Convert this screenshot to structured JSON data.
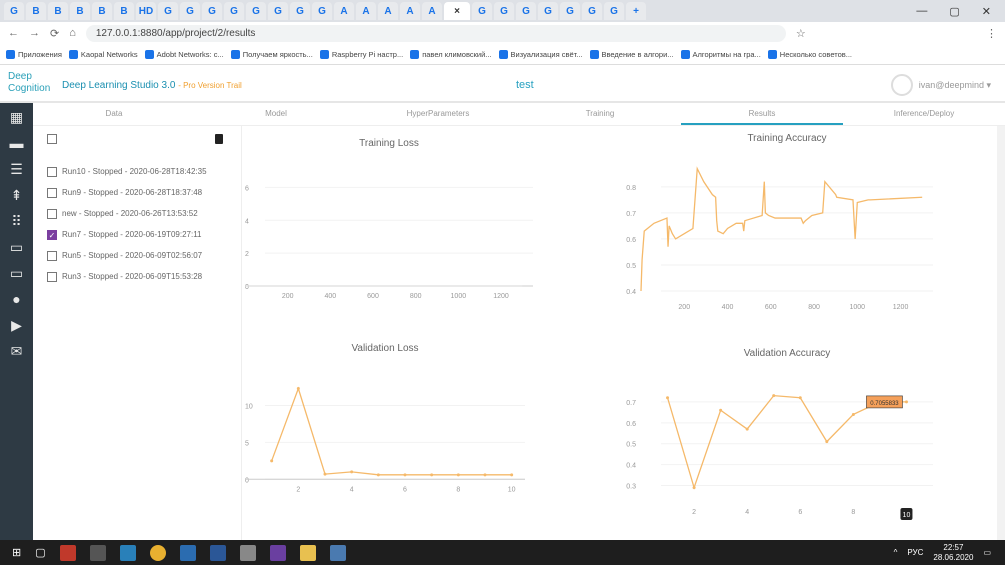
{
  "browser": {
    "url": "127.0.0.1:8880/app/project/2/results",
    "tabs": [
      "G",
      "B",
      "B",
      "B",
      "B",
      "B",
      "HD",
      "G",
      "G",
      "G",
      "G",
      "G",
      "G",
      "G",
      "G",
      "A",
      "A",
      "A",
      "A",
      "A",
      "×",
      "G",
      "G",
      "G",
      "G",
      "G",
      "G",
      "G",
      "+"
    ],
    "bookmarks": [
      "Приложения",
      "Kaopal Networks",
      "Adobt Networks: c...",
      "Получаем яркость...",
      "Raspberry Pi настр...",
      "павел климовский...",
      "Визуализация свёт...",
      "Введение в алгори...",
      "Алгоритмы на гра...",
      "Несколько советов..."
    ]
  },
  "app": {
    "logo": "Deep Cognition",
    "title": "Deep Learning Studio 3.0",
    "badge": "- Pro Version Trail",
    "project": "test",
    "user": "ivan@deepmind ▾"
  },
  "steps": [
    "Data",
    "Model",
    "HyperParameters",
    "Training",
    "Results",
    "Inference/Deploy"
  ],
  "active_step": "Results",
  "runs": [
    {
      "label": "Run10 - Stopped - 2020-06-28T18:42:35",
      "checked": false
    },
    {
      "label": "Run9 - Stopped - 2020-06-28T18:37:48",
      "checked": false
    },
    {
      "label": "new - Stopped - 2020-06-26T13:53:52",
      "checked": false
    },
    {
      "label": "Run7 - Stopped - 2020-06-19T09:27:11",
      "checked": true
    },
    {
      "label": "Run5 - Stopped - 2020-06-09T02:56:07",
      "checked": false
    },
    {
      "label": "Run3 - Stopped - 2020-06-09T15:53:28",
      "checked": false
    }
  ],
  "chart_data": [
    {
      "type": "line",
      "title": "Training Loss",
      "ylim": [
        0,
        7
      ],
      "xlim": [
        0,
        1350
      ],
      "yticks": [
        0,
        2,
        4,
        6
      ],
      "xticks": [
        200,
        400,
        600,
        800,
        1000,
        1200
      ],
      "x": [
        0,
        1300
      ],
      "values": [
        0,
        0
      ]
    },
    {
      "type": "line",
      "title": "Training Accuracy",
      "ylim": [
        0.4,
        0.88
      ],
      "xlim": [
        0,
        1350
      ],
      "yticks": [
        0.4,
        0.5,
        0.6,
        0.7,
        0.8
      ],
      "xticks": [
        200,
        400,
        600,
        800,
        1000,
        1200
      ],
      "x": [
        0,
        5,
        15,
        60,
        120,
        125,
        130,
        145,
        160,
        200,
        240,
        260,
        290,
        330,
        345,
        350,
        355,
        380,
        400,
        440,
        470,
        475,
        480,
        560,
        570,
        575,
        590,
        620,
        660,
        740,
        750,
        760,
        790,
        840,
        850,
        900,
        905,
        980,
        990,
        1000,
        1050,
        1060,
        1300
      ],
      "values": [
        0.4,
        0.52,
        0.63,
        0.66,
        0.68,
        0.57,
        0.65,
        0.62,
        0.6,
        0.62,
        0.64,
        0.87,
        0.82,
        0.77,
        0.76,
        0.67,
        0.63,
        0.62,
        0.64,
        0.66,
        0.66,
        0.63,
        0.67,
        0.69,
        0.82,
        0.7,
        0.69,
        0.68,
        0.68,
        0.68,
        0.66,
        0.67,
        0.69,
        0.7,
        0.82,
        0.77,
        0.76,
        0.75,
        0.6,
        0.74,
        0.75,
        0.75,
        0.76
      ]
    },
    {
      "type": "line",
      "title": "Validation Loss",
      "ylim": [
        -2,
        14
      ],
      "xlim": [
        0,
        10.5
      ],
      "yticks": [
        0,
        5,
        10
      ],
      "xticks": [
        2,
        4,
        6,
        8,
        10
      ],
      "x": [
        1,
        2,
        3,
        4,
        5,
        6,
        7,
        8,
        9,
        10
      ],
      "values": [
        2.5,
        12.3,
        0.7,
        1,
        0.6,
        0.6,
        0.6,
        0.6,
        0.6,
        0.6
      ]
    },
    {
      "type": "line",
      "title": "Validation Accuracy",
      "ylim": [
        0.25,
        0.8
      ],
      "xlim": [
        0,
        11
      ],
      "yticks": [
        0.3,
        0.4,
        0.5,
        0.6,
        0.7
      ],
      "xticks": [
        2,
        4,
        6,
        8,
        10
      ],
      "x": [
        1,
        2,
        3,
        4,
        5,
        6,
        7,
        8,
        9,
        10
      ],
      "values": [
        0.72,
        0.29,
        0.66,
        0.57,
        0.73,
        0.72,
        0.51,
        0.64,
        0.7,
        0.7
      ],
      "tooltip": "0.7055833",
      "hover_x_label": "10"
    }
  ],
  "taskbar": {
    "lang": "РУС",
    "time": "22:57",
    "date": "28.06.2020"
  }
}
